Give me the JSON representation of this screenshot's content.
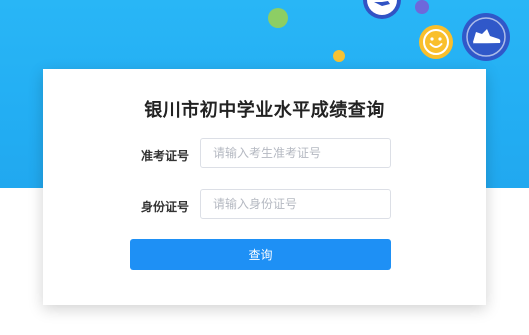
{
  "page": {
    "title": "银川市初中学业水平成绩查询"
  },
  "form": {
    "exam_number": {
      "label": "准考证号",
      "placeholder": "请输入考生准考证号",
      "value": ""
    },
    "id_number": {
      "label": "身份证号",
      "placeholder": "请输入身份证号",
      "value": ""
    },
    "submit_label": "查询"
  },
  "decorations": {
    "icons": [
      "smiley-face-icon",
      "sneaker-icon",
      "sneaker-badge-icon"
    ]
  },
  "colors": {
    "banner": "#29b6f6",
    "button": "#1e90f5",
    "accent_yellow": "#fbc02d",
    "accent_navy": "#2f55c8"
  }
}
